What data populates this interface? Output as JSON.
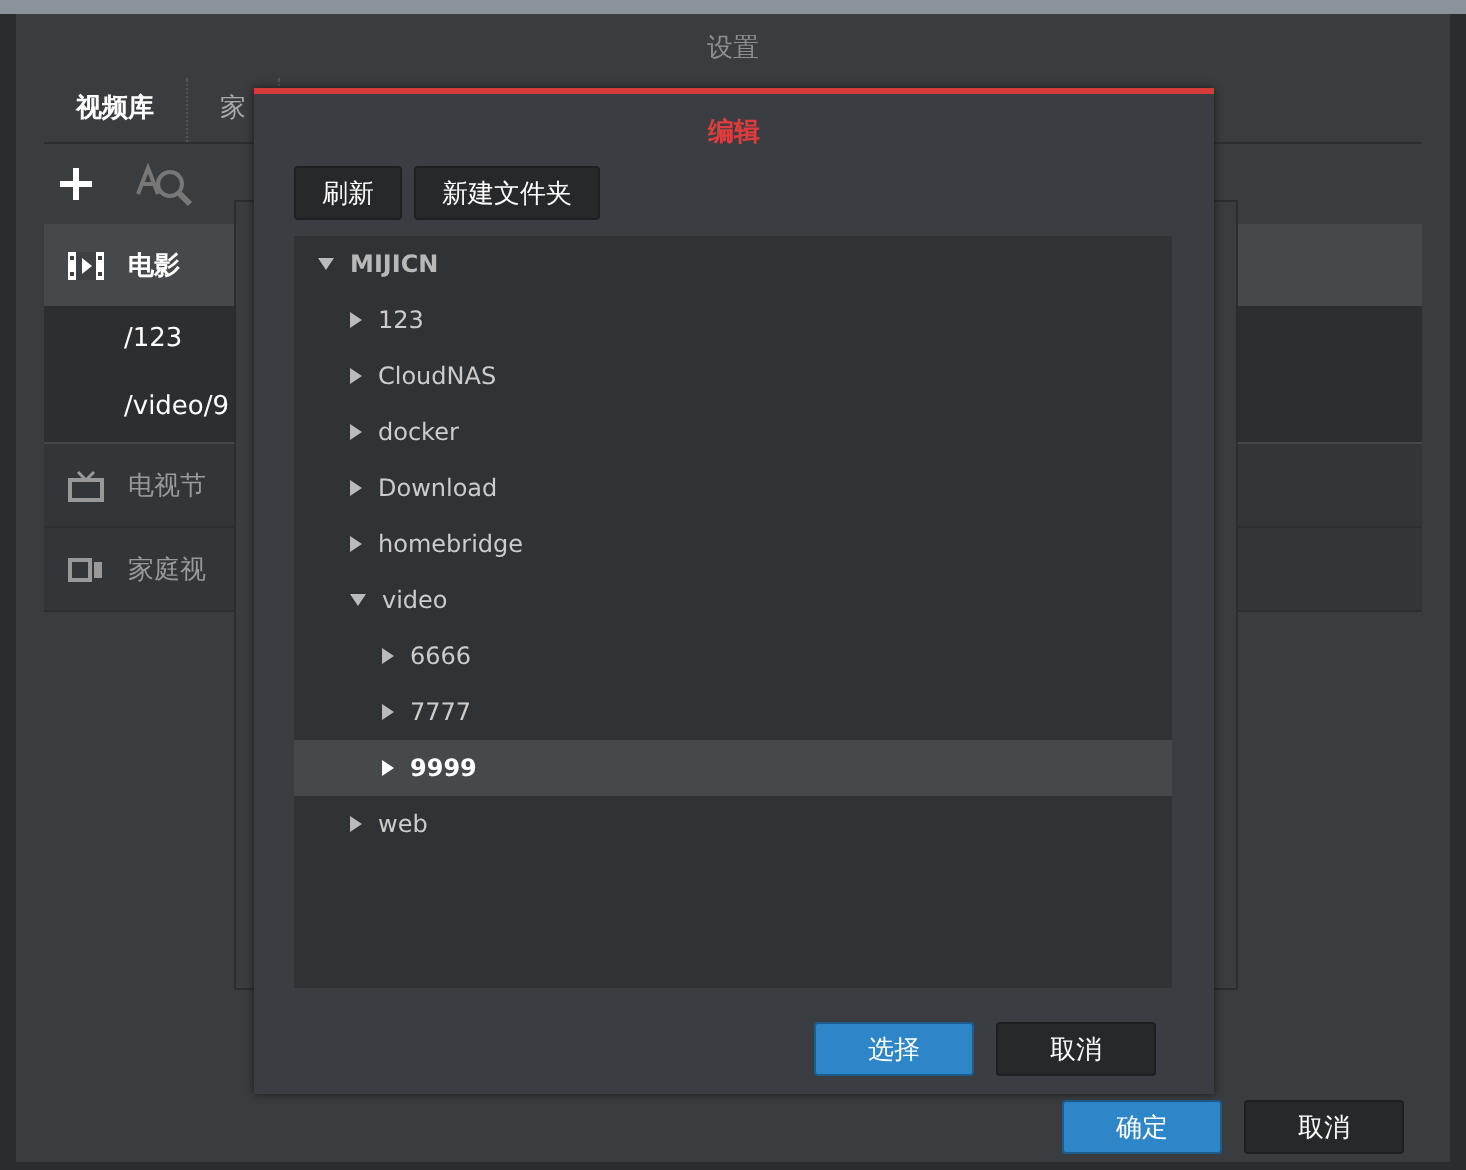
{
  "window": {
    "title": "设置"
  },
  "tabs": [
    {
      "label": "视频库",
      "selected": true
    },
    {
      "label": "家",
      "selected": false
    }
  ],
  "sidebar": {
    "items": [
      {
        "label": "电影",
        "kind": "movie",
        "selected": true,
        "children": [
          {
            "label": "/123"
          },
          {
            "label": "/video/9"
          }
        ]
      },
      {
        "label": "电视节",
        "kind": "tv",
        "selected": false
      },
      {
        "label": "家庭视",
        "kind": "camera",
        "selected": false
      }
    ]
  },
  "footer_buttons": [
    {
      "label": "确定",
      "kind": "primary"
    },
    {
      "label": "取消",
      "kind": "secondary"
    }
  ],
  "dialog": {
    "title": "编辑",
    "toolbar": [
      "刷新",
      "新建文件夹"
    ],
    "tree": [
      {
        "label": "MIJICN",
        "expanded": true,
        "selected": false,
        "children": [
          {
            "label": "123",
            "expanded": false,
            "selected": false
          },
          {
            "label": "CloudNAS",
            "expanded": false,
            "selected": false
          },
          {
            "label": "docker",
            "expanded": false,
            "selected": false
          },
          {
            "label": "Download",
            "expanded": false,
            "selected": false
          },
          {
            "label": "homebridge",
            "expanded": false,
            "selected": false
          },
          {
            "label": "video",
            "expanded": true,
            "selected": false,
            "children": [
              {
                "label": "6666",
                "expanded": false,
                "selected": false
              },
              {
                "label": "7777",
                "expanded": false,
                "selected": false
              },
              {
                "label": "9999",
                "expanded": false,
                "selected": true
              }
            ]
          },
          {
            "label": "web",
            "expanded": false,
            "selected": false
          }
        ]
      }
    ],
    "buttons": [
      {
        "label": "选择",
        "kind": "primary"
      },
      {
        "label": "取消",
        "kind": "secondary"
      }
    ]
  }
}
